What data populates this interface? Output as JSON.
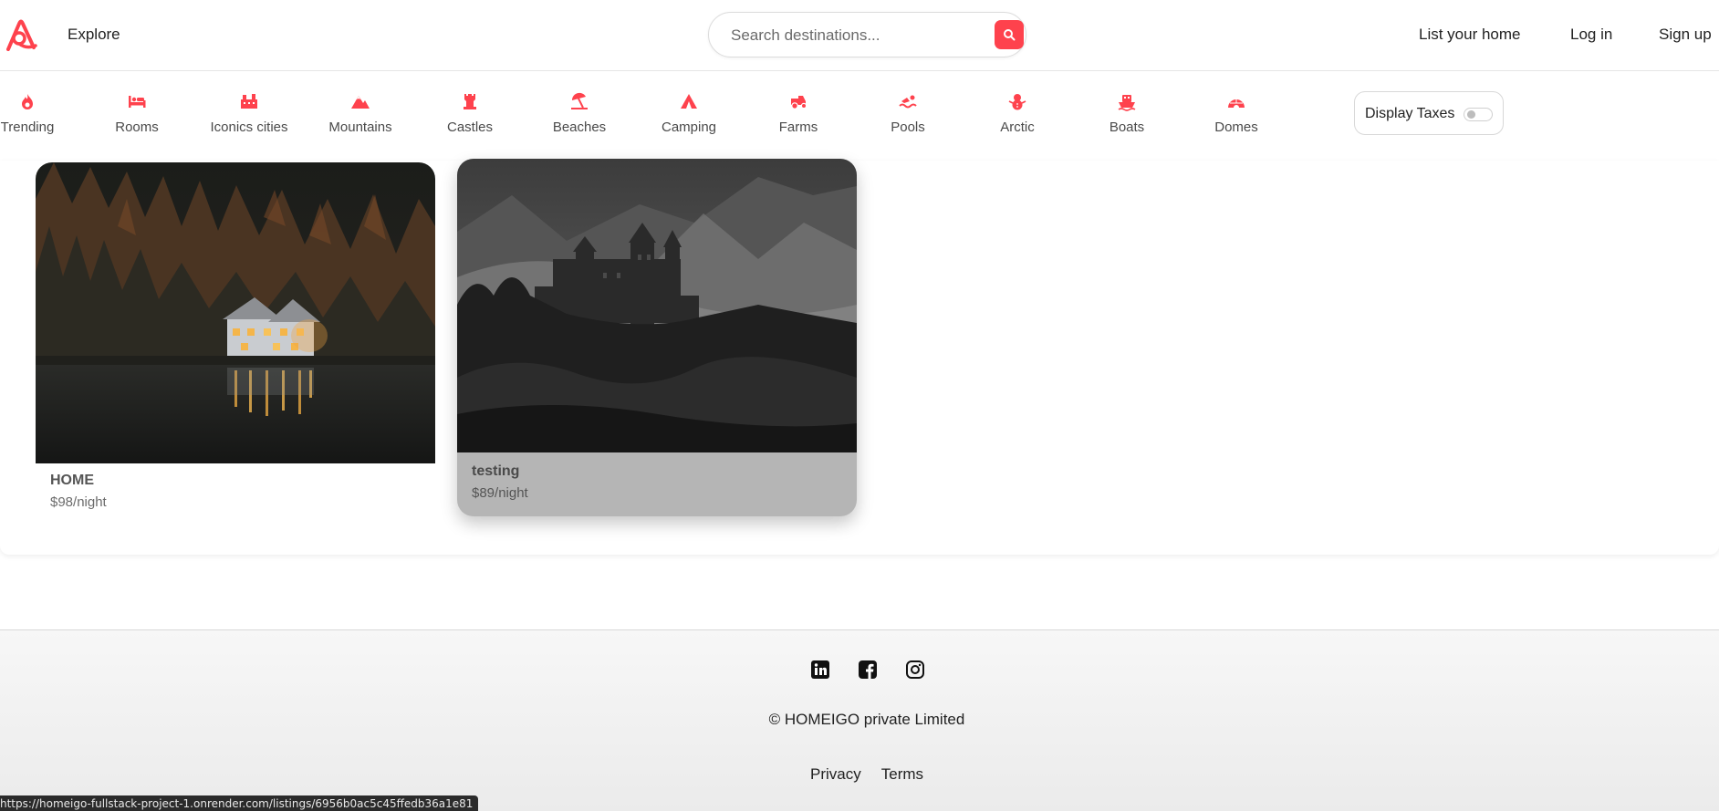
{
  "navbar": {
    "explore_label": "Explore",
    "search_placeholder": "Search destinations...",
    "list_home_label": "List your home",
    "login_label": "Log in",
    "signup_label": "Sign up"
  },
  "filters": [
    {
      "label": "Trending",
      "icon": "fire-icon"
    },
    {
      "label": "Rooms",
      "icon": "bed-icon"
    },
    {
      "label": "Iconics cities",
      "icon": "city-icon"
    },
    {
      "label": "Mountains",
      "icon": "mountain-icon"
    },
    {
      "label": "Castles",
      "icon": "castle-icon"
    },
    {
      "label": "Beaches",
      "icon": "umbrella-beach-icon"
    },
    {
      "label": "Camping",
      "icon": "tent-icon"
    },
    {
      "label": "Farms",
      "icon": "tractor-icon"
    },
    {
      "label": "Pools",
      "icon": "swimmer-icon"
    },
    {
      "label": "Arctic",
      "icon": "snowman-icon"
    },
    {
      "label": "Boats",
      "icon": "ship-icon"
    },
    {
      "label": "Domes",
      "icon": "igloo-icon"
    }
  ],
  "tax_toggle": {
    "label": "Display Taxes",
    "enabled": false
  },
  "listings": [
    {
      "title": "HOME",
      "price": "$98/night"
    },
    {
      "title": "testing",
      "price": "$89/night"
    }
  ],
  "footer": {
    "socials": [
      "linkedin-icon",
      "facebook-icon",
      "instagram-icon"
    ],
    "copyright": "© HOMEIGO private Limited",
    "privacy_label": "Privacy",
    "terms_label": "Terms"
  },
  "status_bar": {
    "url": "https://homeigo-fullstack-project-1.onrender.com/listings/6956b0ac5c45ffedb36a1e81"
  },
  "colors": {
    "accent": "#fe424d",
    "text": "#222222"
  }
}
